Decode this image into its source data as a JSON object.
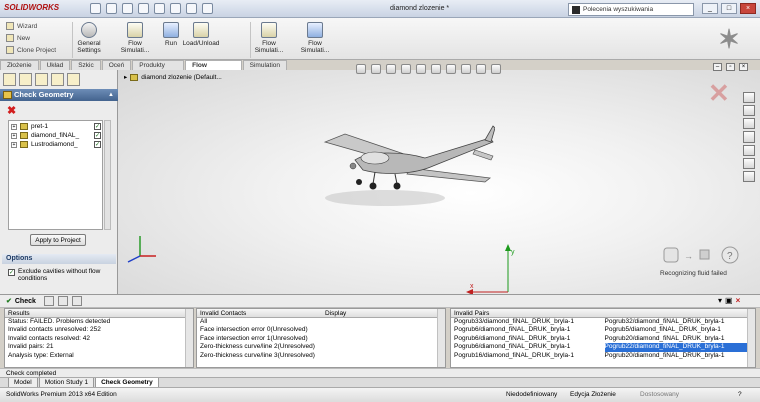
{
  "app": {
    "brand": "SOLIDWORKS",
    "doc_title": "diamond zlozenie *",
    "search_placeholder": "Polecenia wyszukiwania",
    "window_buttons": [
      "_",
      "□",
      "×"
    ]
  },
  "command_manager": {
    "small_items": [
      "Wizard",
      "New",
      "Clone Project"
    ],
    "buttons": [
      {
        "label": "General Settings",
        "icon": "gear-icon"
      },
      {
        "label": "Flow Simulati...",
        "icon": "flow-sim-icon"
      },
      {
        "label": "Run",
        "icon": "run-icon"
      },
      {
        "label": "Load/Unload",
        "icon": "load-unload-icon"
      },
      {
        "label": "Flow Simulati...",
        "icon": "flow-sim-icon"
      },
      {
        "label": "Flow Simulati...",
        "icon": "flow-sim-icon"
      }
    ]
  },
  "tabs": [
    "Złożenie",
    "Układ",
    "Szkic",
    "Oceń",
    "Produkty Office",
    "Flow Simulation",
    "Simulation"
  ],
  "active_tab": "Flow Simulation",
  "property_manager": {
    "title": "Check Geometry",
    "tree": [
      {
        "name": "pret-1",
        "checked": true
      },
      {
        "name": "diamond_fiNAL_",
        "checked": true
      },
      {
        "name": "Lustrodiamond_",
        "checked": true
      }
    ],
    "apply_label": "Apply to Project",
    "options_title": "Options",
    "option_exclude": "Exclude cavities without flow conditions"
  },
  "viewport": {
    "feature_tree_root": "diamond zlozenie  (Default...",
    "message": "Recognizing fluid failed",
    "axis_x": "x",
    "axis_y": "y"
  },
  "check_panel": {
    "title": "Check",
    "results": {
      "header": "Results",
      "rows": [
        "Status: FAILED. Problems detected",
        "Invalid contacts unresolved: 252",
        "Invalid contacts resolved: 42",
        "Invalid pairs: 21",
        "Analysis type: External"
      ]
    },
    "contacts": {
      "header": "Invalid Contacts",
      "header2": "Display",
      "rows": [
        "All",
        "Face intersection error 0(Unresolved)",
        "Face intersection error 1(Unresolved)",
        "Zero-thickness curve/line 2(Unresolved)",
        "Zero-thickness curve/line 3(Unresolved)"
      ]
    },
    "pairs": {
      "header": "Invalid Pairs",
      "rows": [
        [
          "Pogrub33/diamond_fiNAL_DRUK_bryla-1",
          "Pogrub32/diamond_fiNAL_DRUK_bryla-1"
        ],
        [
          "Pogrub6/diamond_fiNAL_DRUK_bryla-1",
          "Pogrub5/diamond_fiNAL_DRUK_bryla-1"
        ],
        [
          "Pogrub6/diamond_fiNAL_DRUK_bryla-1",
          "Pogrub20/diamond_fiNAL_DRUK_bryla-1"
        ],
        [
          "Pogrub6/diamond_fiNAL_DRUK_bryla-1",
          "Pogrub22/diamond_fiNAL_DRUK_bryla-1"
        ],
        [
          "Pogrub16/diamond_fiNAL_DRUK_bryla-1",
          "Pogrub20/diamond_fiNAL_DRUK_bryla-1"
        ]
      ],
      "selected_row": 3
    }
  },
  "status_message": "Check completed",
  "bottom_tabs": [
    "Model",
    "Motion Study 1",
    "Check Geometry"
  ],
  "active_bottom_tab": "Check Geometry",
  "statusbar": {
    "edition": "SolidWorks Premium 2013 x64 Edition",
    "state": "Niedodefiniowany",
    "mode": "Edycja Złożenie",
    "customize": "Dostosowany"
  }
}
